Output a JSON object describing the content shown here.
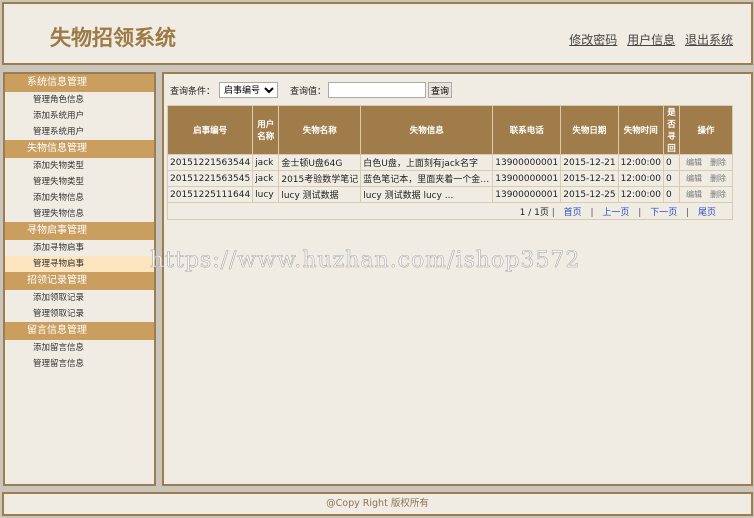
{
  "header": {
    "title": "失物招领系统",
    "links": [
      "修改密码",
      "用户信息",
      "退出系统"
    ]
  },
  "sidebar": [
    {
      "title": "系统信息管理",
      "items": [
        "管理角色信息",
        "添加系统用户",
        "管理系统用户"
      ]
    },
    {
      "title": "失物信息管理",
      "items": [
        "添加失物类型",
        "管理失物类型",
        "添加失物信息",
        "管理失物信息"
      ]
    },
    {
      "title": "寻物启事管理",
      "items": [
        "添加寻物启事",
        "管理寻物启事"
      ]
    },
    {
      "title": "招领记录管理",
      "items": [
        "添加领取记录",
        "管理领取记录"
      ]
    },
    {
      "title": "留言信息管理",
      "items": [
        "添加留言信息",
        "管理留言信息"
      ]
    }
  ],
  "active_item": "管理寻物启事",
  "search": {
    "condition_label": "查询条件：",
    "condition_value": "启事编号",
    "value_label": "查询值：",
    "value": "",
    "button": "查询"
  },
  "table": {
    "headers": [
      "启事编号",
      "用户名称",
      "失物名称",
      "失物信息",
      "联系电话",
      "失物日期",
      "失物时间",
      "是否寻回",
      "操作"
    ],
    "rows": [
      [
        "20151221563544",
        "jack",
        "金士顿U盘64G",
        "白色U盘，上面刻有jack名字",
        "13900000001",
        "2015-12-21",
        "12:00:00",
        "0"
      ],
      [
        "20151221563545",
        "jack",
        "2015考验数学笔记",
        "蓝色笔记本，里面夹着一个金士顿...",
        "13900000001",
        "2015-12-21",
        "12:00:00",
        "0"
      ],
      [
        "20151225111644",
        "lucy",
        "lucy 测试数据",
        "lucy 测试数据 lucy ...",
        "13900000001",
        "2015-12-25",
        "12:00:00",
        "0"
      ]
    ],
    "actions": [
      "编辑",
      "删除"
    ]
  },
  "pagination": {
    "page": "1 / 1页",
    "first": "首页",
    "prev": "上一页",
    "next": "下一页",
    "last": "尾页"
  },
  "footer": "@Copy Right 版权所有",
  "watermark": "https://www.huzhan.com/ishop3572"
}
